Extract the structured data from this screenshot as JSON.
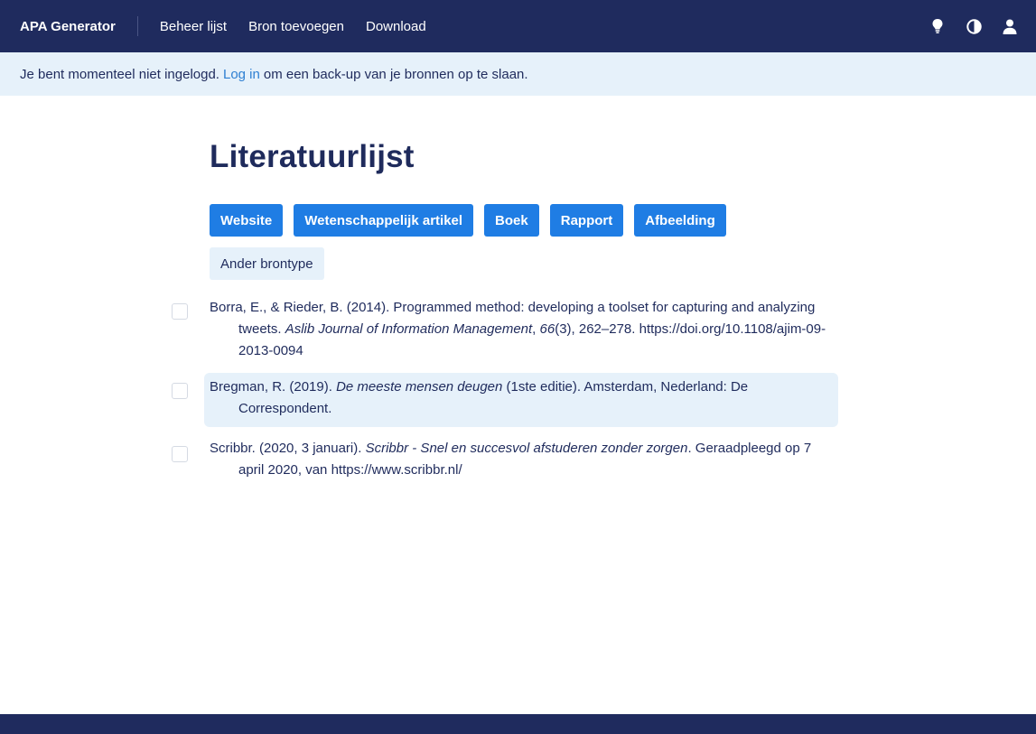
{
  "header": {
    "brand": "APA Generator",
    "nav": [
      "Beheer lijst",
      "Bron toevoegen",
      "Download"
    ],
    "icons": [
      "lightbulb-icon",
      "contrast-icon",
      "user-icon"
    ]
  },
  "login_notice": {
    "before": "Je bent momenteel niet ingelogd.",
    "link": "Log in",
    "after": "om een back-up van je bronnen op te slaan."
  },
  "main": {
    "title": "Literatuurlijst",
    "source_buttons": [
      "Website",
      "Wetenschappelijk artikel",
      "Boek",
      "Rapport",
      "Afbeelding"
    ],
    "other_button": "Ander brontype"
  },
  "references": [
    {
      "pre": "Borra, E., & Rieder, B. (2014). Programmed method: developing a toolset for capturing and analyzing tweets. ",
      "journal": "Aslib Journal of Information Management",
      "sep": ", ",
      "volume": "66",
      "post": "(3), 262–278. https://doi.org/10.1108/ajim-09-2013-0094"
    },
    {
      "pre": "Bregman, R. (2019). ",
      "title": "De meeste mensen deugen",
      "post": " (1ste editie). Amsterdam, Nederland: De Correspondent."
    },
    {
      "pre": "Scribbr. (2020, 3 januari). ",
      "title": "Scribbr - Snel en succesvol afstuderen zonder zorgen",
      "post": ". Geraadpleegd op 7 april 2020, van https://www.scribbr.nl/"
    }
  ],
  "colors": {
    "navy": "#1f2b5e",
    "primary": "#1f7de4",
    "light": "#e6f1fa",
    "link": "#2d7fd2"
  }
}
